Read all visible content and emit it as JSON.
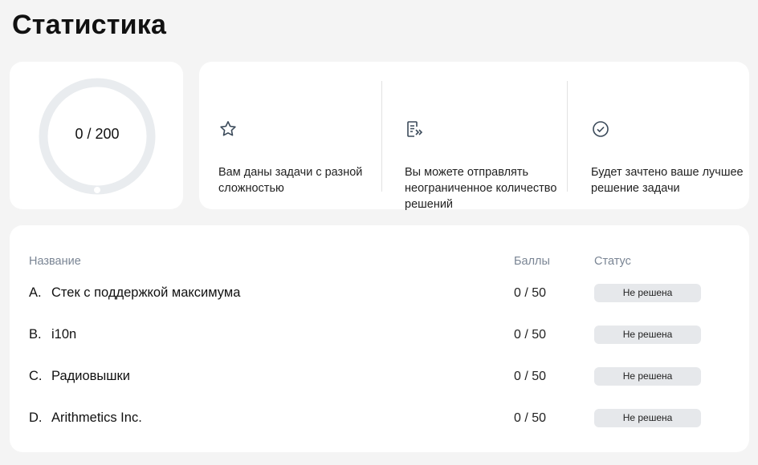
{
  "page": {
    "title": "Статистика"
  },
  "score": {
    "text": "0 / 200",
    "progress": 0
  },
  "info": [
    {
      "icon": "star-icon",
      "text": "Вам даны задачи с разной сложностью"
    },
    {
      "icon": "document-send-icon",
      "text": "Вы можете отправлять неограниченное количество решений"
    },
    {
      "icon": "check-circle-icon",
      "text": "Будет зачтено ваше лучшее решение задачи"
    }
  ],
  "table": {
    "headers": {
      "name": "Название",
      "score": "Баллы",
      "status": "Статус"
    },
    "rows": [
      {
        "letter": "A.",
        "name": "Стек с поддержкой максимума",
        "score": "0 / 50",
        "status": "Не решена"
      },
      {
        "letter": "B.",
        "name": "i10n",
        "score": "0 / 50",
        "status": "Не решена"
      },
      {
        "letter": "C.",
        "name": "Радиовышки",
        "score": "0 / 50",
        "status": "Не решена"
      },
      {
        "letter": "D.",
        "name": "Arithmetics Inc.",
        "score": "0 / 50",
        "status": "Не решена"
      }
    ]
  }
}
